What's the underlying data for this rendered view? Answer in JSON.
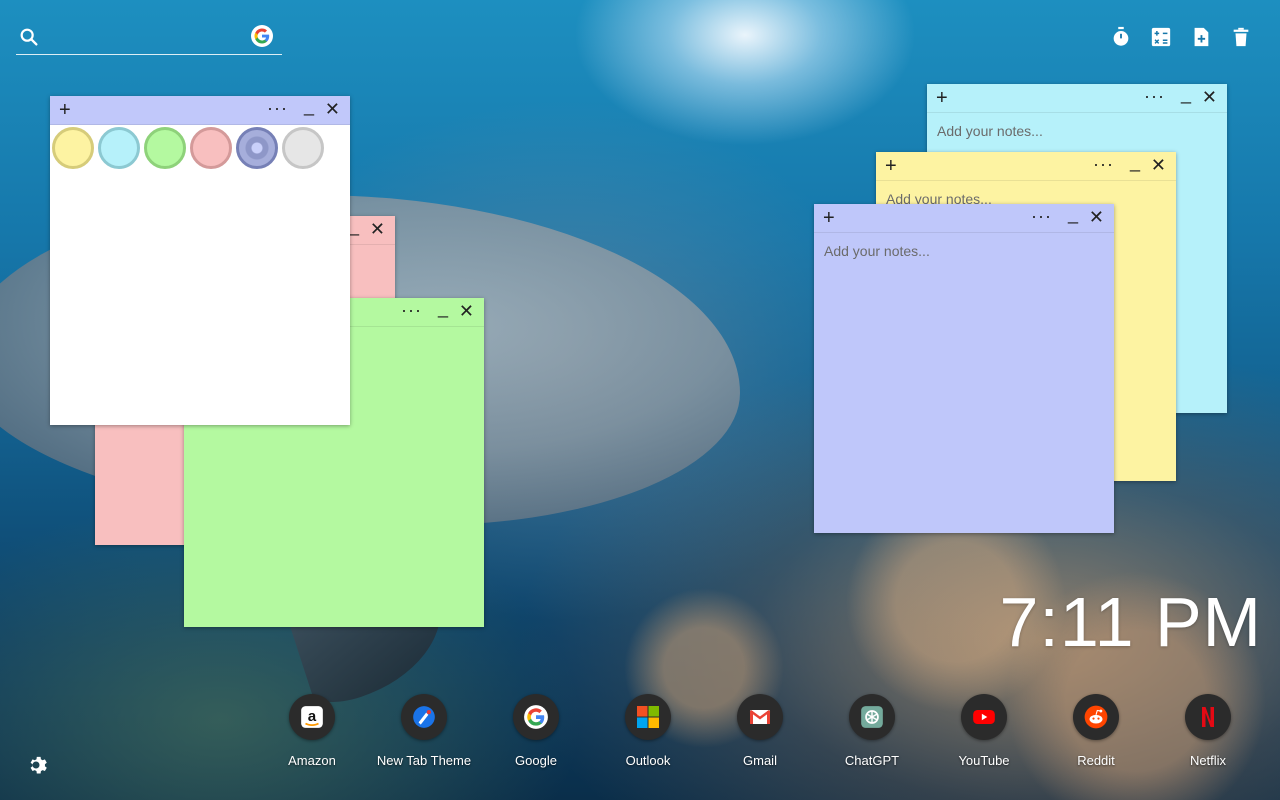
{
  "search": {
    "placeholder": "",
    "value": ""
  },
  "toolbar": {
    "items": [
      {
        "name": "timer-icon"
      },
      {
        "name": "calculator-icon"
      },
      {
        "name": "new-note-icon"
      },
      {
        "name": "trash-icon"
      }
    ]
  },
  "notes": [
    {
      "color": "#f8bfbf",
      "header_color": "#f8bfbf",
      "placeholder": ""
    },
    {
      "color": "#b4f9a0",
      "header_color": "#b4f9a0",
      "placeholder": ""
    },
    {
      "color": "#ffffff",
      "header_color": "#c1c8fa",
      "placeholder": ""
    },
    {
      "color": "#b6f1fa",
      "header_color": "#b6f1fa",
      "placeholder": "Add your notes..."
    },
    {
      "color": "#fdf3a2",
      "header_color": "#fdf3a2",
      "placeholder": "Add your notes..."
    },
    {
      "color": "#bfc7fa",
      "header_color": "#bfc7fa",
      "placeholder": "Add your notes..."
    }
  ],
  "note_controls": {
    "plus": "+",
    "more": "···",
    "minimize": "_",
    "close": "✕"
  },
  "color_picker": {
    "swatches": [
      "#fdf3a2",
      "#b6f1fa",
      "#b4f9a0",
      "#f8bfbf",
      "#8e97c8",
      "#e6e6e6"
    ],
    "selected_index": 4
  },
  "clock": {
    "time": "7:11 PM"
  },
  "shortcuts": [
    {
      "label": "Amazon",
      "icon": "amazon-icon"
    },
    {
      "label": "New Tab Theme",
      "icon": "new-tab-theme-icon"
    },
    {
      "label": "Google",
      "icon": "google-icon"
    },
    {
      "label": "Outlook",
      "icon": "outlook-icon"
    },
    {
      "label": "Gmail",
      "icon": "gmail-icon"
    },
    {
      "label": "ChatGPT",
      "icon": "chatgpt-icon"
    },
    {
      "label": "YouTube",
      "icon": "youtube-icon"
    },
    {
      "label": "Reddit",
      "icon": "reddit-icon"
    },
    {
      "label": "Netflix",
      "icon": "netflix-icon"
    }
  ],
  "settings": {
    "icon": "gear-icon"
  }
}
